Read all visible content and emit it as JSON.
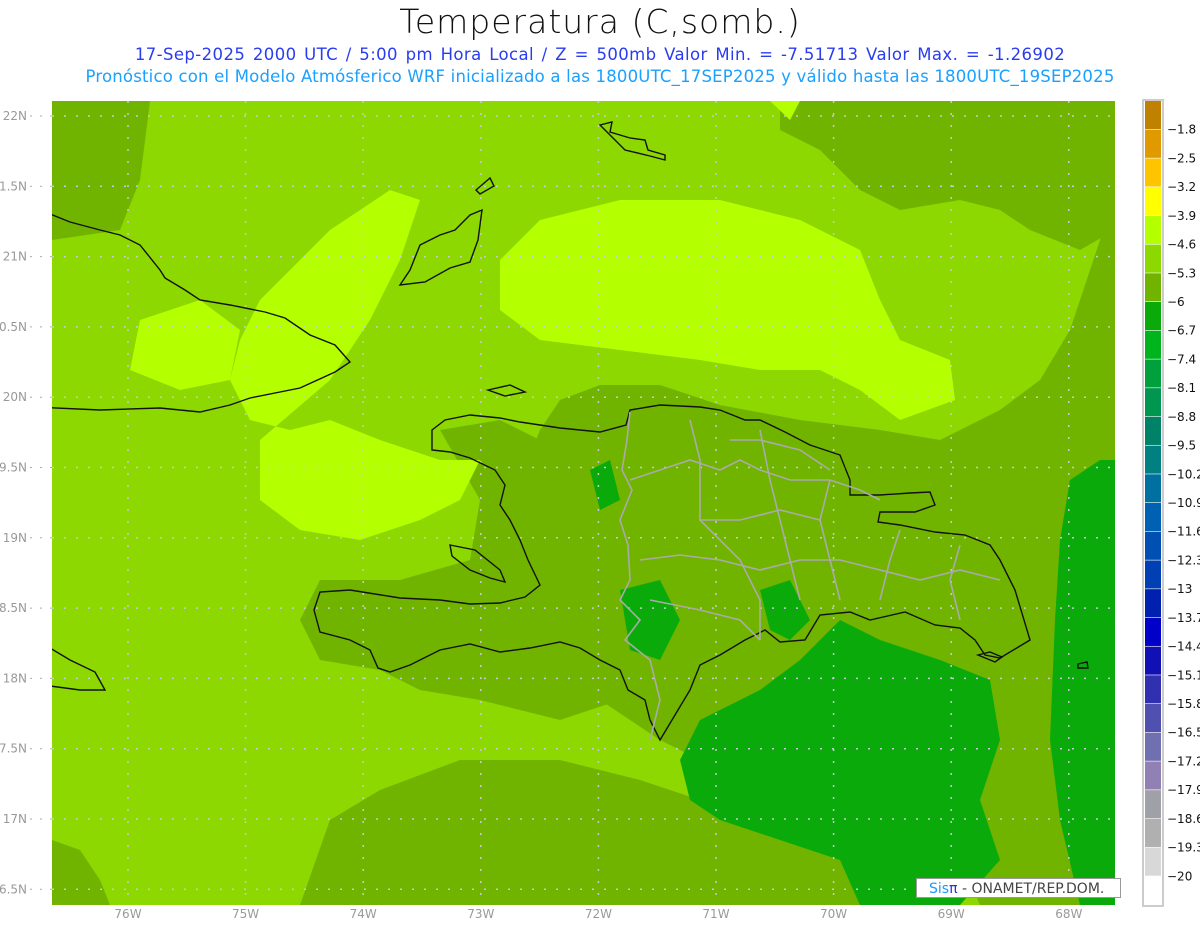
{
  "header": {
    "title": "Temperatura (C,somb.)",
    "info_line": "17-Sep-2025  2000 UTC / 5:00 pm Hora Local / Z = 500mb  Valor Min. = -7.51713  Valor Max. = -1.26902",
    "model_line": "Pronóstico con el Modelo Atmósferico WRF inicializado a las 1800UTC_17SEP2025 y válido hasta las  1800UTC_19SEP2025"
  },
  "axes": {
    "lon_labels": [
      "76W",
      "75W",
      "74W",
      "73W",
      "72W",
      "71W",
      "70W",
      "69W",
      "68W"
    ],
    "lat_labels": [
      "22N",
      "1.5N",
      "21N",
      "0.5N",
      "20N",
      "9.5N",
      "19N",
      "8.5N",
      "18N",
      "7.5N",
      "17N",
      "6.5N"
    ]
  },
  "colorbar": {
    "labels": [
      "-1.8",
      "-2.5",
      "-3.2",
      "-3.9",
      "-4.6",
      "-5.3",
      "-6",
      "-6.7",
      "-7.4",
      "-8.1",
      "-8.8",
      "-9.5",
      "-10.2",
      "-10.9",
      "-11.6",
      "-12.3",
      "-13",
      "-13.7",
      "-14.4",
      "-15.1",
      "-15.8",
      "-16.5",
      "-17.2",
      "-17.9",
      "-18.6",
      "-19.3",
      "-20"
    ],
    "colors": [
      "#c08000",
      "#e09a00",
      "#ffc400",
      "#ffff00",
      "#b4ff00",
      "#8cd800",
      "#70b400",
      "#0aaa0a",
      "#00b41e",
      "#00a03c",
      "#009650",
      "#008268",
      "#008080",
      "#0070a0",
      "#0060b4",
      "#0050b4",
      "#0040b4",
      "#0020b0",
      "#0000c8",
      "#1010b4",
      "#3030b0",
      "#5050b0",
      "#7070b0",
      "#9080b4",
      "#a0a0a8",
      "#b0b0b0",
      "#d8d8d8",
      "#ffffff"
    ]
  },
  "logo": {
    "sis": "Sis",
    "pi": "π",
    "org": " -  ONAMET/REP.DOM."
  }
}
